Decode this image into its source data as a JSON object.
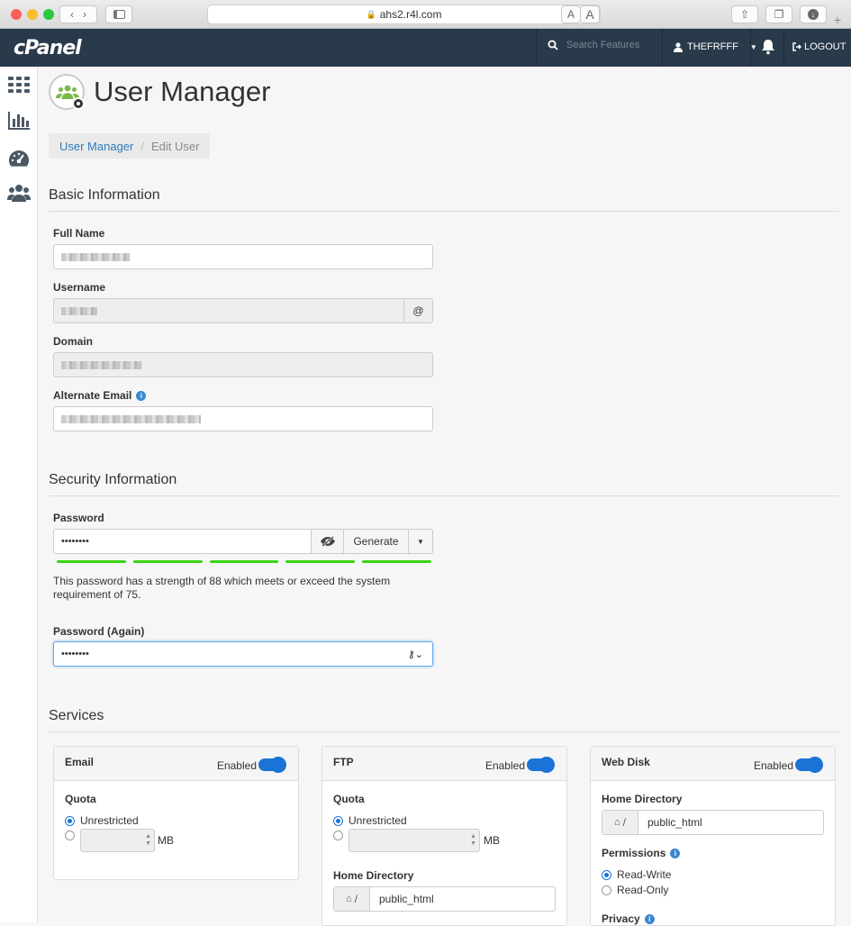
{
  "browser": {
    "url": "ahs2.r4l.com",
    "font_small": "A",
    "font_large": "A"
  },
  "topbar": {
    "logo": "cPanel",
    "search_placeholder": "Search Features",
    "username": "THEFRFFF",
    "logout": "LOGOUT",
    "bg_color": "#293a4a"
  },
  "page": {
    "title": "User Manager",
    "breadcrumb": {
      "link": "User Manager",
      "separator": "/",
      "current": "Edit User"
    }
  },
  "basic": {
    "title": "Basic Information",
    "full_name_label": "Full Name",
    "username_label": "Username",
    "username_addon": "@",
    "domain_label": "Domain",
    "alt_email_label": "Alternate Email"
  },
  "security": {
    "title": "Security Information",
    "password_label": "Password",
    "password_value": "••••••••",
    "generate": "Generate",
    "strength_text": "This password has a strength of 88 which meets or exceed the system requirement of 75.",
    "password_again_label": "Password (Again)",
    "password_again_value": "••••••••",
    "strength_color": "#3bd415"
  },
  "services": {
    "title": "Services",
    "enabled": "Enabled",
    "email": {
      "title": "Email",
      "quota_label": "Quota",
      "unrestricted": "Unrestricted",
      "unit": "MB"
    },
    "ftp": {
      "title": "FTP",
      "quota_label": "Quota",
      "unrestricted": "Unrestricted",
      "unit": "MB",
      "home_label": "Home Directory",
      "home_prefix": "/",
      "home_value": "public_html"
    },
    "webdisk": {
      "title": "Web Disk",
      "home_label": "Home Directory",
      "home_prefix": "/",
      "home_value": "public_html",
      "permissions_label": "Permissions",
      "read_write": "Read-Write",
      "read_only": "Read-Only",
      "privacy_label": "Privacy"
    },
    "toggle_color": "#1a73d6"
  }
}
